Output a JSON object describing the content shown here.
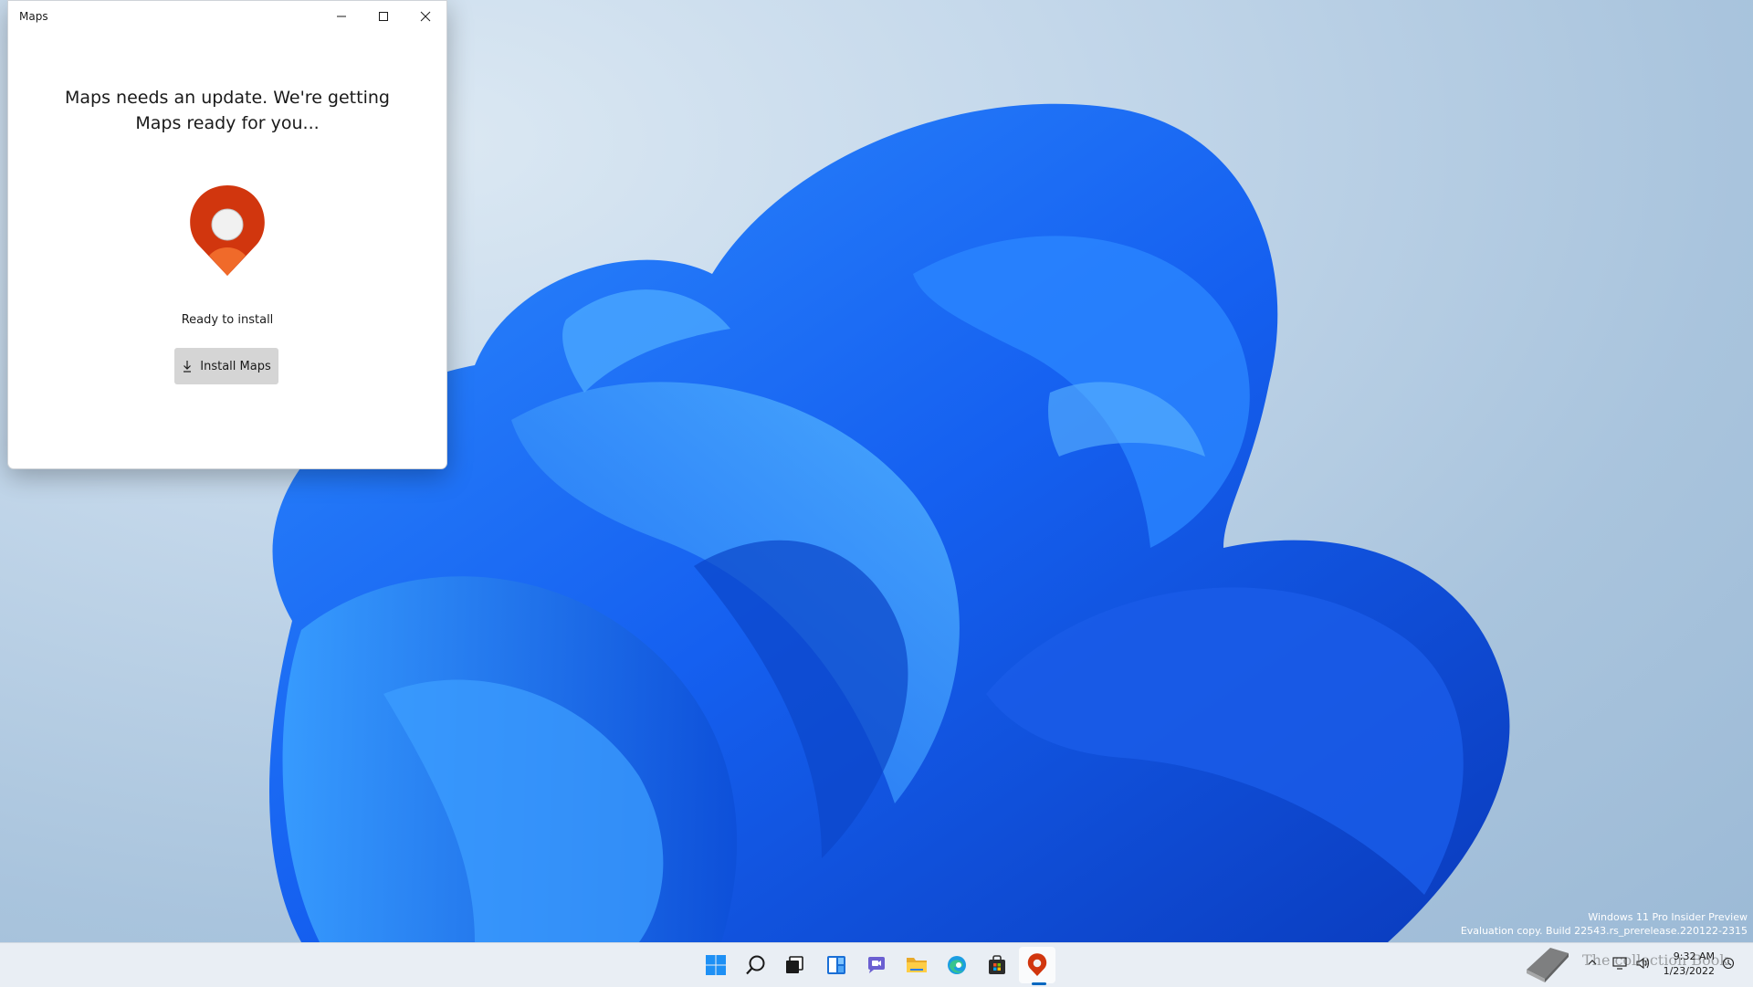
{
  "window": {
    "title": "Maps",
    "heading": "Maps needs an update. We're getting Maps ready for you...",
    "status": "Ready to install",
    "install_label": "Install Maps",
    "logo_color": "#d1360e"
  },
  "watermark": {
    "line1": "Windows 11 Pro Insider Preview",
    "line2": "Evaluation copy. Build 22543.rs_prerelease.220122-2315"
  },
  "taskbar": {
    "background": "#e9eef4",
    "apps": [
      {
        "name": "start-icon"
      },
      {
        "name": "search-icon"
      },
      {
        "name": "task-view-icon"
      },
      {
        "name": "widgets-icon"
      },
      {
        "name": "chat-icon"
      },
      {
        "name": "file-explorer-icon"
      },
      {
        "name": "edge-icon"
      },
      {
        "name": "store-icon"
      },
      {
        "name": "maps-icon",
        "active": true
      }
    ],
    "tray": {
      "overlay_text": "The collection Book",
      "time": "9:32 AM",
      "date": "1/23/2022"
    }
  }
}
